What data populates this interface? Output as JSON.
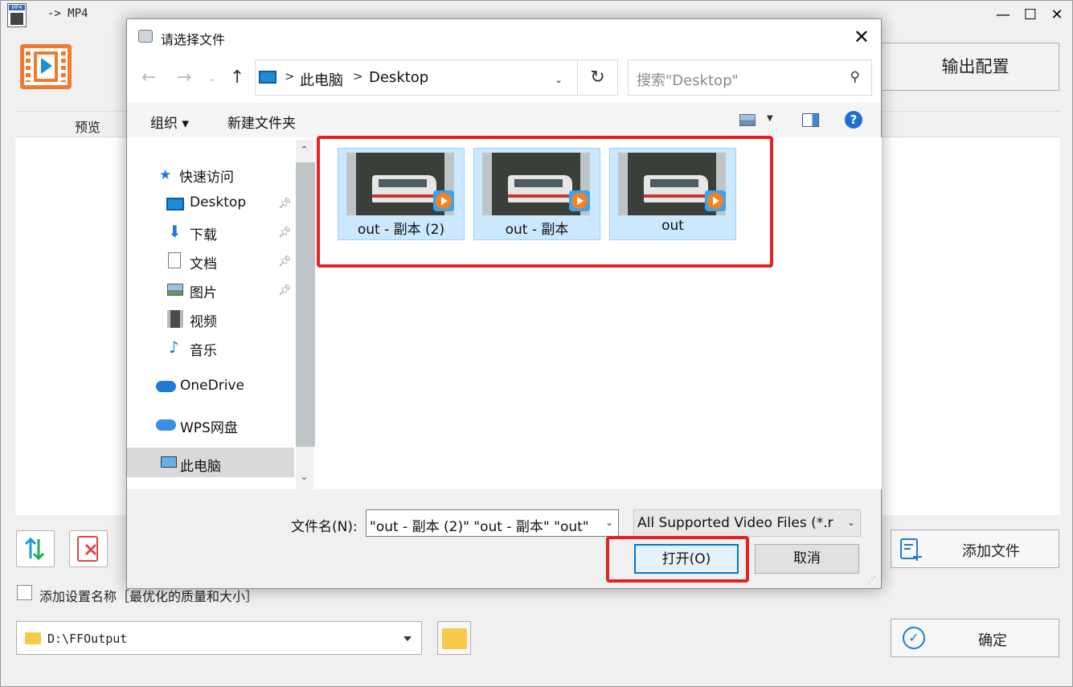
{
  "app": {
    "title": "-> MP4",
    "icon_badge": "MP4",
    "output_config_label": "输出配置",
    "preview_label": "预览",
    "add_file_label": "添加文件",
    "add_setting_label": "添加设置名称［最优化的质量和大小］",
    "output_path": "D:\\FFOutput",
    "ok_label": "确定",
    "window_controls": [
      "minimize-icon",
      "maximize-icon",
      "close-icon"
    ]
  },
  "dialog": {
    "title": "请选择文件",
    "close_glyph": "✕",
    "address": {
      "crumbs": [
        "此电脑",
        "Desktop"
      ]
    },
    "search": {
      "placeholder": "搜索\"Desktop\""
    },
    "toolbar": {
      "organize": "组织 ▾",
      "new_folder": "新建文件夹",
      "help": "?"
    },
    "nav": [
      {
        "label": "快速访问",
        "icon": "star-icon"
      },
      {
        "label": "Desktop",
        "icon": "desktop-icon",
        "pinned": true
      },
      {
        "label": "下载",
        "icon": "download-icon",
        "pinned": true
      },
      {
        "label": "文档",
        "icon": "document-icon",
        "pinned": true
      },
      {
        "label": "图片",
        "icon": "picture-icon",
        "pinned": true
      },
      {
        "label": "视频",
        "icon": "video-icon"
      },
      {
        "label": "音乐",
        "icon": "music-icon"
      },
      {
        "label": "OneDrive",
        "icon": "cloud-icon"
      },
      {
        "label": "WPS网盘",
        "icon": "cloud-icon"
      },
      {
        "label": "此电脑",
        "icon": "computer-icon",
        "selected": true
      }
    ],
    "files": [
      {
        "name": "out - 副本 (2)",
        "selected": true
      },
      {
        "name": "out - 副本",
        "selected": true
      },
      {
        "name": "out",
        "selected": true
      }
    ],
    "filename_label": "文件名(N):",
    "filename_value": "\"out - 副本 (2)\" \"out - 副本\" \"out\"",
    "filetype_value": "All Supported Video Files (*.r",
    "open_label": "打开(O)",
    "cancel_label": "取消"
  },
  "colors": {
    "highlight": "#e52222",
    "selection": "#cce8ff",
    "accent": "#0078d7"
  }
}
